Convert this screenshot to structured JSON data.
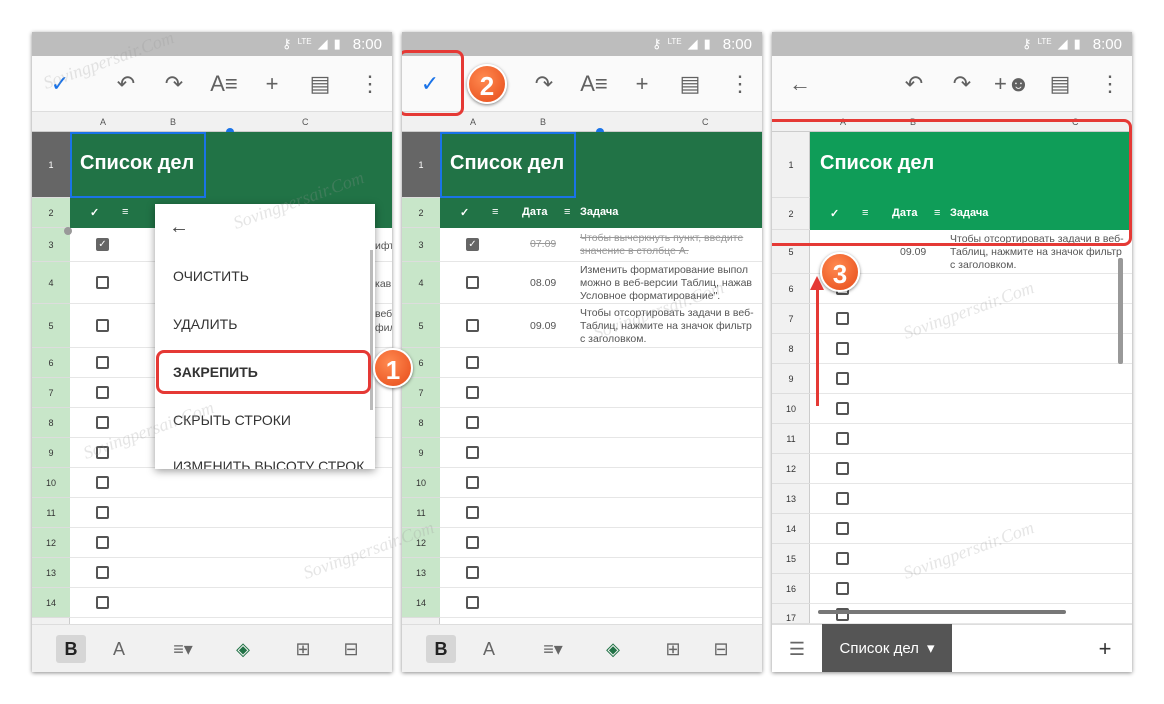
{
  "status": {
    "network": "LTE",
    "time": "8:00"
  },
  "sheet": {
    "title": "Список дел",
    "columns": [
      "A",
      "B",
      "C"
    ],
    "headers": {
      "check": "✓",
      "date": "Дата",
      "task": "Задача"
    },
    "tasks": [
      {
        "row": "3",
        "checked": true,
        "date": "07.09",
        "text": [
          "Чтобы вычеркнуть пункт, введите",
          "значение в столбце А."
        ]
      },
      {
        "row": "4",
        "checked": false,
        "date": "08.09",
        "text": [
          "Изменить форматирование выпол",
          "можно в веб-версии Таблиц, нажав",
          "Условное форматирование\"."
        ]
      },
      {
        "row": "5",
        "checked": false,
        "date": "09.09",
        "text": [
          "Чтобы отсортировать задачи в веб-",
          "Таблиц, нажмите на значок фильтр",
          "с заголовком."
        ]
      }
    ]
  },
  "menu": {
    "items": [
      "ОЧИСТИТЬ",
      "УДАЛИТЬ",
      "ЗАКРЕПИТЬ",
      "СКРЫТЬ СТРОКИ",
      "ИЗМЕНИТЬ ВЫСОТУ СТРОК"
    ],
    "clipped": [
      "ифта",
      "кав",
      "веб",
      "фильт"
    ]
  },
  "badges": [
    "1",
    "2",
    "3"
  ],
  "bottom": {
    "bold": "B",
    "text_color": "A",
    "sheet_tab": "Список дел",
    "add": "+"
  },
  "watermark": "Sovingpersair.Com",
  "colors": {
    "green": "#217346",
    "accent": "#1a73e8",
    "badge": "#e64a19",
    "frame": "#e53935"
  }
}
